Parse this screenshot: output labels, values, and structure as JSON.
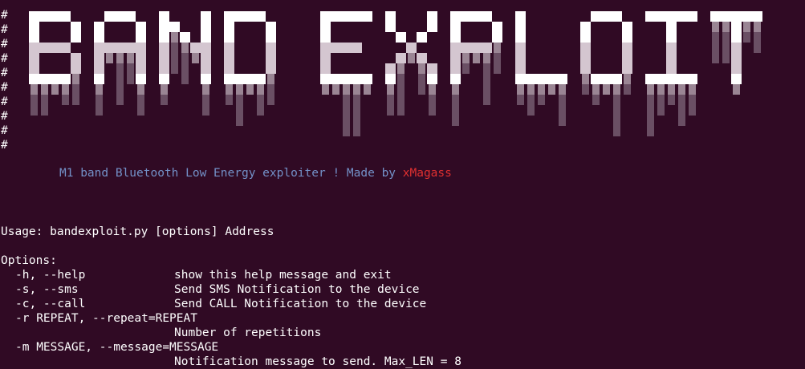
{
  "window": {
    "background": "#300a24",
    "text_color": "#ffffff"
  },
  "banner": {
    "text": "BAND EXPLOIT",
    "comment_marks": [
      "#",
      "#",
      "#",
      "#",
      "#",
      "#",
      "#",
      "#",
      "#",
      "#"
    ],
    "colors": {
      "top": "#ffffff",
      "mid": "#d4c6d0",
      "drip": "#9a8594",
      "drip_dark": "#6a4f64"
    }
  },
  "tagline": {
    "text": "M1 band Bluetooth Low Energy exploiter ! Made by ",
    "author": "xMagass",
    "text_color": "#7391c8",
    "author_color": "#e03030"
  },
  "usage": "Usage: bandexploit.py [options] Address",
  "options_header": "Options:",
  "options": [
    {
      "flag": "-h, --help",
      "desc": "show this help message and exit"
    },
    {
      "flag": "-s, --sms",
      "desc": "Send SMS Notification to the device"
    },
    {
      "flag": "-c, --call",
      "desc": "Send CALL Notification to the device"
    },
    {
      "flag": "-r REPEAT, --repeat=REPEAT",
      "desc": "Number of repetitions"
    },
    {
      "flag": "-m MESSAGE, --message=MESSAGE",
      "desc": "Notification message to send. Max_LEN = 8"
    }
  ]
}
